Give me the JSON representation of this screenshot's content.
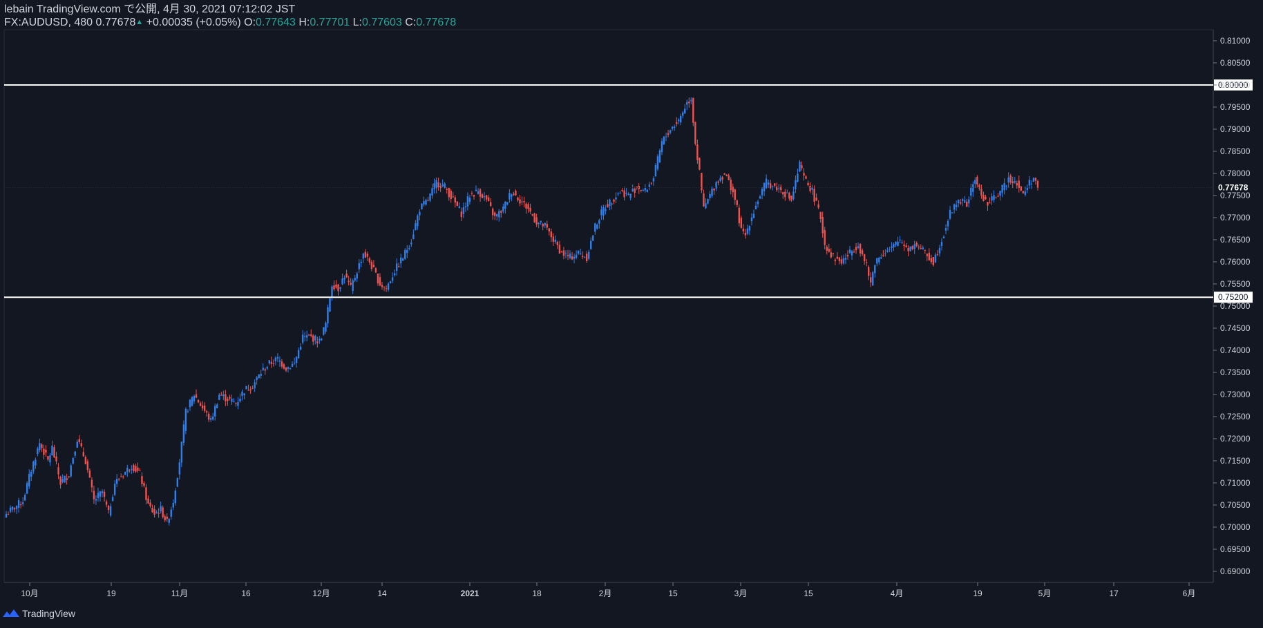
{
  "header": {
    "line1": "lebain TradingView.com で公開, 4月 30, 2021 07:12:02 JST",
    "symbol": "FX:AUDUSD, 480",
    "price": "0.77678",
    "change": "+0.00035 (+0.05%)",
    "o_label": "O:",
    "o_value": "0.77643",
    "h_label": "H:",
    "h_value": "0.77701",
    "l_label": "L:",
    "l_value": "0.77603",
    "c_label": "C:",
    "c_value": "0.77678"
  },
  "footer": {
    "brand": "TradingView",
    "logo_icon": "tradingview-logo-icon"
  },
  "colors": {
    "background": "#131722",
    "up": "#2f80ed",
    "down": "#ef5350",
    "text": "#d1d4dc",
    "teal": "#26a69a",
    "line": "#ffffff"
  },
  "chart_data": {
    "type": "candlestick",
    "symbol": "FX:AUDUSD",
    "interval": "480",
    "ylim": [
      0.6875,
      0.8125
    ],
    "y_ticks": [
      "0.81000",
      "0.80500",
      "0.80000",
      "0.79500",
      "0.79000",
      "0.78500",
      "0.78000",
      "0.77500",
      "0.77000",
      "0.76500",
      "0.76000",
      "0.75500",
      "0.75000",
      "0.74500",
      "0.74000",
      "0.73500",
      "0.73000",
      "0.72500",
      "0.72000",
      "0.71500",
      "0.71000",
      "0.70500",
      "0.70000",
      "0.69500",
      "0.69000"
    ],
    "x_ticks": [
      "10月",
      "19",
      "11月",
      "16",
      "12月",
      "14",
      "2021",
      "18",
      "2月",
      "15",
      "3月",
      "15",
      "4月",
      "19",
      "5月",
      "17",
      "6月"
    ],
    "horizontal_lines": [
      {
        "value": 0.8,
        "label": "0.80000"
      },
      {
        "value": 0.752,
        "label": "0.75200"
      }
    ],
    "last_price": {
      "value": 0.77678,
      "label": "0.77678"
    },
    "close_path": [
      [
        0,
        0.703
      ],
      [
        8,
        0.706
      ],
      [
        12,
        0.713
      ],
      [
        16,
        0.719
      ],
      [
        20,
        0.715
      ],
      [
        22,
        0.718
      ],
      [
        26,
        0.71
      ],
      [
        30,
        0.712
      ],
      [
        34,
        0.72
      ],
      [
        38,
        0.715
      ],
      [
        42,
        0.706
      ],
      [
        46,
        0.708
      ],
      [
        49,
        0.703
      ],
      [
        52,
        0.71
      ],
      [
        56,
        0.712
      ],
      [
        60,
        0.714
      ],
      [
        64,
        0.712
      ],
      [
        68,
        0.705
      ],
      [
        71,
        0.703
      ],
      [
        74,
        0.704
      ],
      [
        77,
        0.701
      ],
      [
        80,
        0.706
      ],
      [
        83,
        0.715
      ],
      [
        86,
        0.726
      ],
      [
        88,
        0.728
      ],
      [
        90,
        0.73
      ],
      [
        94,
        0.727
      ],
      [
        98,
        0.724
      ],
      [
        102,
        0.73
      ],
      [
        106,
        0.729
      ],
      [
        110,
        0.728
      ],
      [
        114,
        0.731
      ],
      [
        118,
        0.732
      ],
      [
        122,
        0.735
      ],
      [
        126,
        0.737
      ],
      [
        130,
        0.738
      ],
      [
        134,
        0.736
      ],
      [
        138,
        0.737
      ],
      [
        142,
        0.743
      ],
      [
        146,
        0.743
      ],
      [
        150,
        0.742
      ],
      [
        153,
        0.746
      ],
      [
        156,
        0.755
      ],
      [
        159,
        0.754
      ],
      [
        162,
        0.757
      ],
      [
        165,
        0.754
      ],
      [
        168,
        0.758
      ],
      [
        171,
        0.762
      ],
      [
        174,
        0.76
      ],
      [
        176,
        0.758
      ],
      [
        179,
        0.755
      ],
      [
        182,
        0.754
      ],
      [
        186,
        0.758
      ],
      [
        190,
        0.761
      ],
      [
        194,
        0.765
      ],
      [
        198,
        0.772
      ],
      [
        202,
        0.774
      ],
      [
        206,
        0.778
      ],
      [
        210,
        0.777
      ],
      [
        214,
        0.774
      ],
      [
        218,
        0.771
      ],
      [
        222,
        0.775
      ],
      [
        226,
        0.776
      ],
      [
        230,
        0.774
      ],
      [
        234,
        0.77
      ],
      [
        238,
        0.772
      ],
      [
        242,
        0.776
      ],
      [
        246,
        0.774
      ],
      [
        250,
        0.772
      ],
      [
        254,
        0.769
      ],
      [
        258,
        0.768
      ],
      [
        262,
        0.765
      ],
      [
        266,
        0.762
      ],
      [
        270,
        0.761
      ],
      [
        274,
        0.762
      ],
      [
        278,
        0.761
      ],
      [
        282,
        0.768
      ],
      [
        286,
        0.772
      ],
      [
        290,
        0.774
      ],
      [
        294,
        0.776
      ],
      [
        298,
        0.775
      ],
      [
        302,
        0.777
      ],
      [
        306,
        0.776
      ],
      [
        310,
        0.779
      ],
      [
        314,
        0.787
      ],
      [
        318,
        0.79
      ],
      [
        322,
        0.792
      ],
      [
        326,
        0.796
      ],
      [
        328,
        0.797
      ],
      [
        330,
        0.787
      ],
      [
        332,
        0.78
      ],
      [
        334,
        0.772
      ],
      [
        336,
        0.774
      ],
      [
        340,
        0.778
      ],
      [
        344,
        0.78
      ],
      [
        348,
        0.776
      ],
      [
        350,
        0.772
      ],
      [
        352,
        0.767
      ],
      [
        354,
        0.766
      ],
      [
        356,
        0.769
      ],
      [
        360,
        0.774
      ],
      [
        364,
        0.778
      ],
      [
        368,
        0.777
      ],
      [
        372,
        0.776
      ],
      [
        376,
        0.774
      ],
      [
        380,
        0.782
      ],
      [
        382,
        0.779
      ],
      [
        386,
        0.776
      ],
      [
        390,
        0.77
      ],
      [
        392,
        0.764
      ],
      [
        396,
        0.761
      ],
      [
        400,
        0.76
      ],
      [
        404,
        0.762
      ],
      [
        408,
        0.764
      ],
      [
        412,
        0.759
      ],
      [
        414,
        0.755
      ],
      [
        416,
        0.76
      ],
      [
        420,
        0.762
      ],
      [
        424,
        0.763
      ],
      [
        428,
        0.765
      ],
      [
        432,
        0.763
      ],
      [
        436,
        0.764
      ],
      [
        440,
        0.762
      ],
      [
        444,
        0.76
      ],
      [
        448,
        0.765
      ],
      [
        452,
        0.771
      ],
      [
        456,
        0.774
      ],
      [
        460,
        0.773
      ],
      [
        464,
        0.779
      ],
      [
        466,
        0.776
      ],
      [
        470,
        0.773
      ],
      [
        474,
        0.775
      ],
      [
        478,
        0.777
      ],
      [
        480,
        0.779
      ],
      [
        484,
        0.778
      ],
      [
        487,
        0.775
      ],
      [
        490,
        0.778
      ],
      [
        492,
        0.779
      ],
      [
        494,
        0.77678
      ]
    ]
  }
}
